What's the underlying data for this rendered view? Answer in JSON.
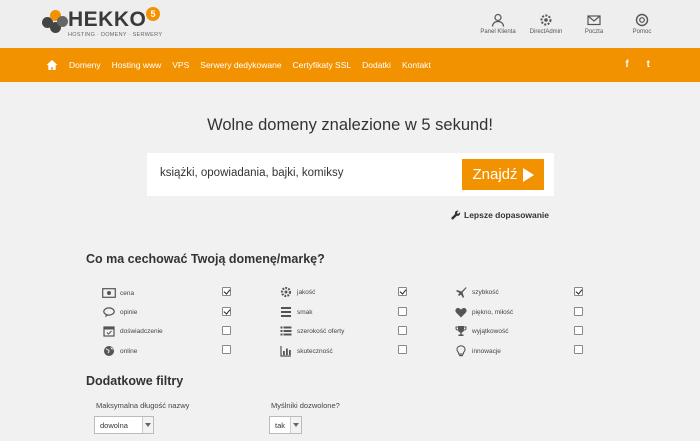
{
  "header": {
    "logo_text": "HEKKO",
    "logo_badge": "5",
    "logo_tagline": "HOSTING · DOMENY · SERWERY",
    "links": [
      {
        "label": "Panel Klienta",
        "icon": "user-icon"
      },
      {
        "label": "DirectAdmin",
        "icon": "gear-icon"
      },
      {
        "label": "Poczta",
        "icon": "mail-icon"
      },
      {
        "label": "Pomoc",
        "icon": "lifebuoy-icon"
      }
    ]
  },
  "nav": {
    "home_icon": "home-icon",
    "items": [
      "Domeny",
      "Hosting www",
      "VPS",
      "Serwery dedykowane",
      "Certyfikaty SSL",
      "Dodatki",
      "Kontakt"
    ],
    "social": {
      "facebook": "f",
      "twitter": "t"
    }
  },
  "main": {
    "headline": "Wolne domeny znalezione w 5 sekund!",
    "search": {
      "value": "książki, opowiadania, bajki, komiksy",
      "button_label": "Znajdź"
    },
    "advanced_link": "Lepsze dopasowanie"
  },
  "features": {
    "title": "Co ma cechować Twoją domenę/markę?",
    "items": [
      {
        "label": "cena",
        "icon": "money-icon",
        "checked": true
      },
      {
        "label": "jakość",
        "icon": "cog-icon",
        "checked": true
      },
      {
        "label": "szybkość",
        "icon": "plane-icon",
        "checked": true
      },
      {
        "label": "opinie",
        "icon": "comment-icon",
        "checked": true
      },
      {
        "label": "smak",
        "icon": "cutlery-icon",
        "checked": false
      },
      {
        "label": "piękno, miłość",
        "icon": "heart-icon",
        "checked": false
      },
      {
        "label": "doświadczenie",
        "icon": "calendar-icon",
        "checked": false
      },
      {
        "label": "szerokość oferty",
        "icon": "list-icon",
        "checked": false
      },
      {
        "label": "wyjątkowość",
        "icon": "trophy-icon",
        "checked": false
      },
      {
        "label": "online",
        "icon": "globe-icon",
        "checked": false
      },
      {
        "label": "skuteczność",
        "icon": "bar-chart-icon",
        "checked": false
      },
      {
        "label": "innowacje",
        "icon": "lightbulb-icon",
        "checked": false
      }
    ]
  },
  "filters": {
    "title": "Dodatkowe filtry",
    "max_length": {
      "label": "Maksymalna długość nazwy",
      "value": "dowolna"
    },
    "hyphens": {
      "label": "Myślniki dozwolone?",
      "value": "tak"
    }
  },
  "colors": {
    "accent": "#f39200",
    "header_bg": "#eeeeee",
    "page_bg": "#f1f1f1"
  }
}
